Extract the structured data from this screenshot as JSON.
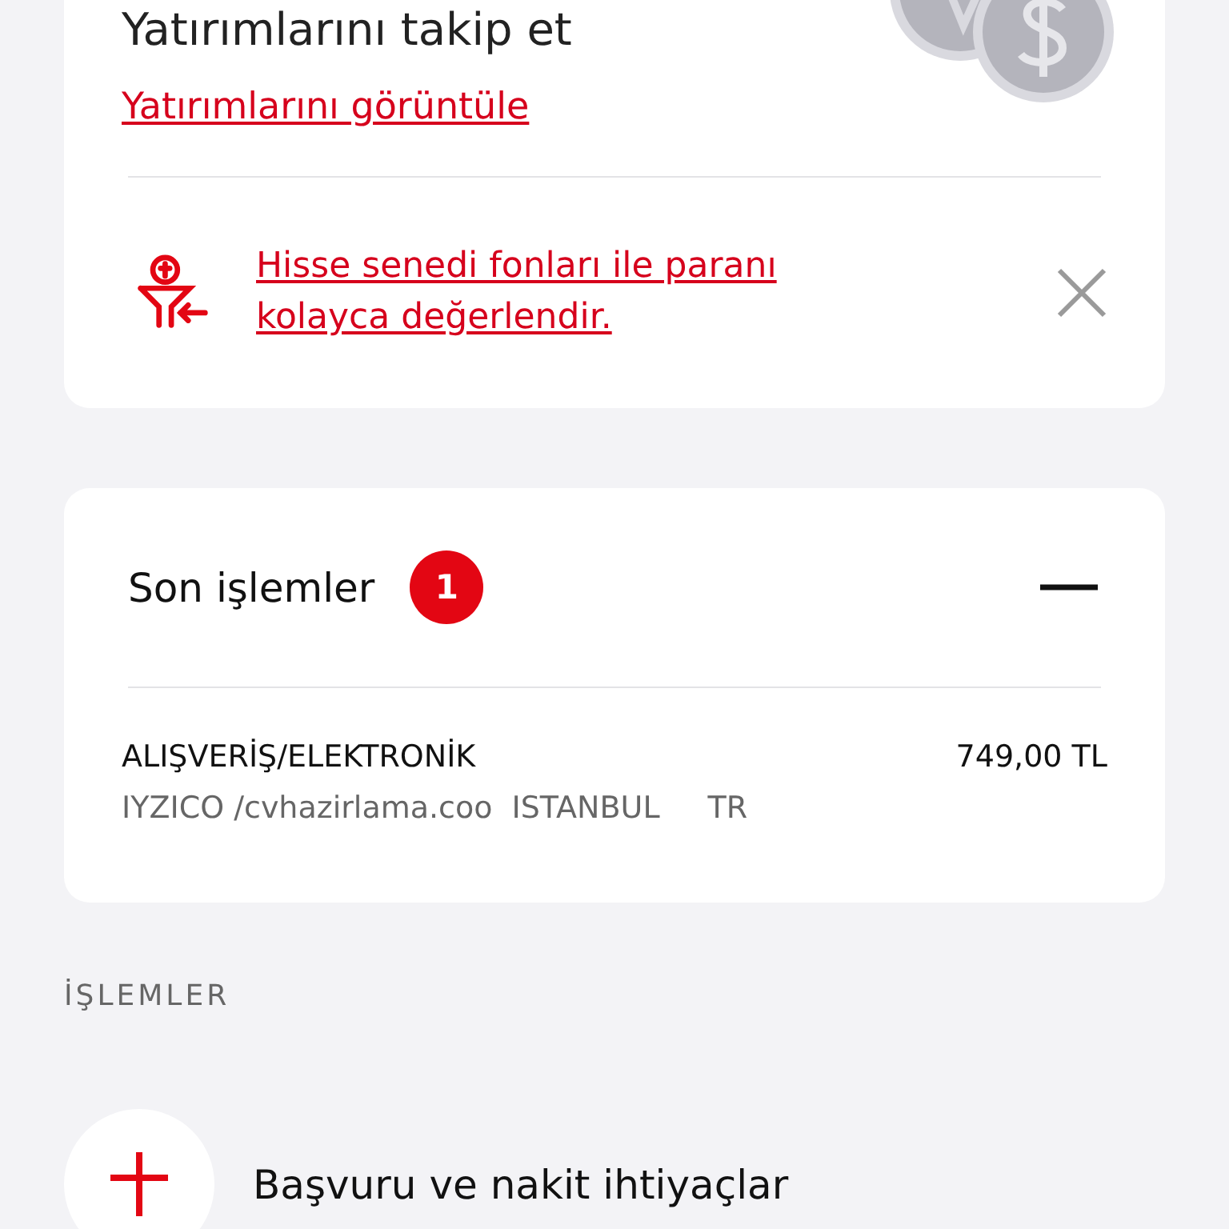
{
  "investment_card": {
    "title": "Yatırımlarını takip et",
    "link": "Yatırımlarını görüntüle",
    "promo": {
      "text": "Hisse senedi fonları ile paranı kolayca değerlendir."
    }
  },
  "recent_transactions": {
    "title": "Son işlemler",
    "count": "1",
    "expanded": true,
    "items": [
      {
        "category": "ALIŞVERİŞ/ELEKTRONİK",
        "amount": "749,00 TL",
        "merchant": "IYZICO /cvhazirlama.coo",
        "city": "ISTANBUL",
        "country": "TR"
      }
    ]
  },
  "section_title": "İŞLEMLER",
  "actions": [
    {
      "label": "Başvuru ve nakit ihtiyaçlar"
    }
  ]
}
